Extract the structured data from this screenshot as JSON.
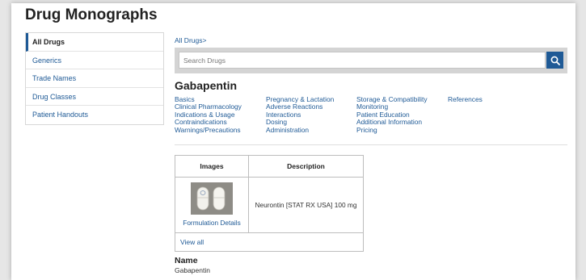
{
  "page": {
    "title": "Drug Monographs"
  },
  "sidebar": {
    "items": [
      {
        "label": "All Drugs",
        "active": true
      },
      {
        "label": "Generics"
      },
      {
        "label": "Trade Names"
      },
      {
        "label": "Drug Classes"
      },
      {
        "label": "Patient Handouts"
      }
    ]
  },
  "breadcrumb": "All Drugs>",
  "search": {
    "placeholder": "Search Drugs",
    "value": "",
    "button_icon": "search-icon"
  },
  "drug": {
    "name": "Gabapentin"
  },
  "sections": {
    "col1": [
      "Basics",
      "Clinical Pharmacology",
      "Indications & Usage",
      "Contraindications",
      "Warnings/Precautions"
    ],
    "col2": [
      "Pregnancy & Lactation",
      "Adverse Reactions",
      "Interactions",
      "Dosing",
      "Administration"
    ],
    "col3": [
      "Storage & Compatibility",
      "Monitoring",
      "Patient Education",
      "Additional Information",
      "Pricing"
    ],
    "col4": [
      "References"
    ]
  },
  "images_table": {
    "headers": {
      "images": "Images",
      "description": "Description"
    },
    "rows": [
      {
        "link": "Formulation Details",
        "description": "Neurontin [STAT RX USA] 100 mg"
      }
    ],
    "view_all": "View all"
  },
  "name_section": {
    "label": "Name",
    "value": "Gabapentin"
  },
  "colors": {
    "link": "#1f5a96",
    "search_button": "#1f5a96",
    "search_bar": "#d4d4d4"
  }
}
